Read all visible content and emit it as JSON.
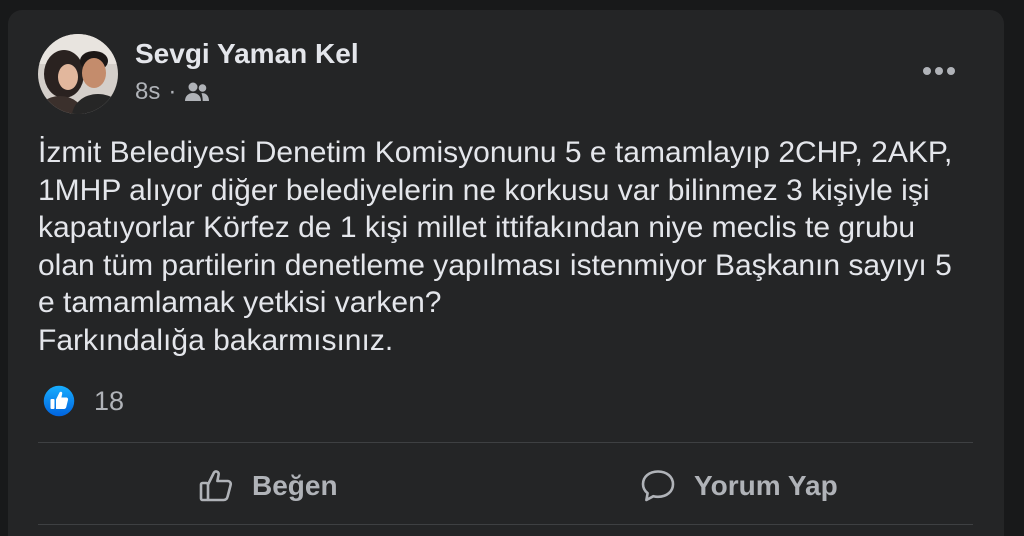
{
  "post": {
    "author": "Sevgi Yaman Kel",
    "time": "8s",
    "separator": "·",
    "audience_icon": "friends-icon",
    "more_icon": "more-horizontal-icon",
    "avatar_icon": "profile-photo",
    "text_lines": [
      "İzmit Belediyesi Denetim Komisyonunu 5 e tamamlayıp 2CHP, 2AKP,",
      "1MHP alıyor diğer belediyelerin ne korkusu var bilinmez 3 kişiyle işi",
      "kapatıyorlar Körfez de 1 kişi millet ittifakından niye meclis te grubu",
      "olan tüm partilerin denetleme yapılması istenmiyor Başkanın sayıyı 5",
      "e tamamlamak yetkisi varken?",
      "Farkındalığa bakarmısınız."
    ]
  },
  "reactions": {
    "icon": "like-reaction-icon",
    "count": "18"
  },
  "actions": {
    "like": {
      "label": "Beğen",
      "icon": "thumbs-up-icon"
    },
    "comment": {
      "label": "Yorum Yap",
      "icon": "comment-icon"
    }
  },
  "colors": {
    "background": "#18191a",
    "card": "#242526",
    "primary_text": "#e4e6eb",
    "secondary_text": "#b0b3b8",
    "divider": "#3e4042",
    "like_blue": "#1877f2"
  }
}
